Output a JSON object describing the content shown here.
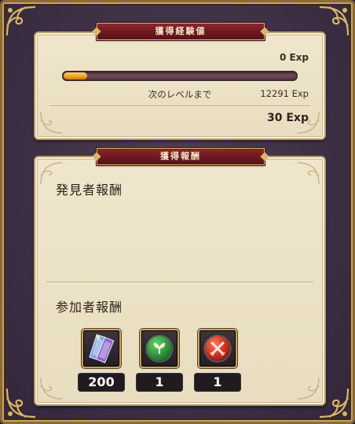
{
  "exp_panel": {
    "banner": "獲得経験値",
    "current_exp": "0 Exp",
    "progress_fraction": 0.1,
    "next_level_label": "次のレベルまで",
    "next_level_value": "12291 Exp",
    "gained_exp": "30 Exp"
  },
  "reward_panel": {
    "banner": "獲得報酬",
    "discoverer_title": "発見者報酬",
    "participant_title": "参加者報酬",
    "items": [
      {
        "icon": "ticket-bundle-icon",
        "count": "200"
      },
      {
        "icon": "green-sprout-orb-icon",
        "count": "1",
        "color": "#2e8b3a"
      },
      {
        "icon": "red-crossed-swords-orb-icon",
        "count": "1",
        "color": "#c0281e"
      }
    ]
  },
  "colors": {
    "frame_gold": "#c9a45a",
    "banner_red": "#6b1820",
    "panel_parchment": "#ece3c8",
    "bar_fill": "#f0a21f"
  }
}
